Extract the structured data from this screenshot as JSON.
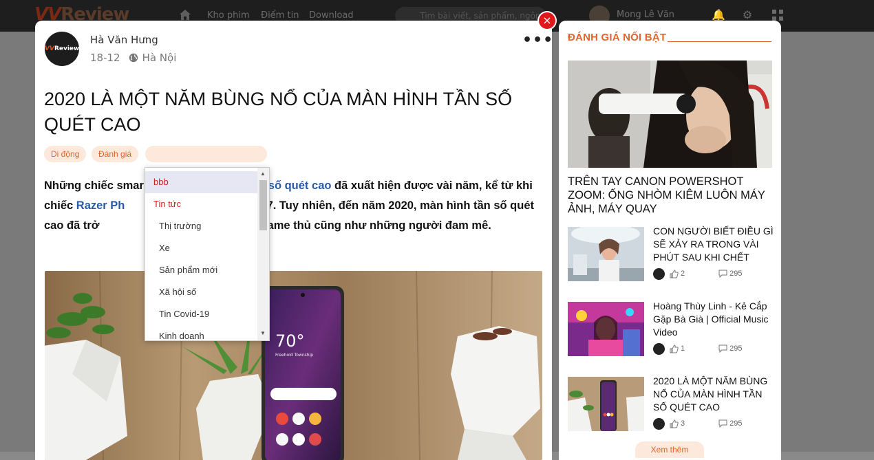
{
  "background": {
    "logo": {
      "prefix": "VV",
      "text": "Review"
    },
    "nav": [
      "Kho phim",
      "Điểm tin",
      "Download"
    ],
    "search_placeholder": "Tìm bài viết, sản phẩm, ngôn",
    "user_name": "Mong Lê Văn"
  },
  "post": {
    "author": "Hà Văn Hưng",
    "avatar_text": {
      "prefix": "VV",
      "text": "Review"
    },
    "date": "18-12",
    "location": "Hà Nội",
    "more": "•••",
    "title": "2020 LÀ MỘT NĂM BÙNG NỔ CỦA MÀN HÌNH TẦN SỐ QUÉT CAO",
    "tags": [
      "Di động",
      "Đánh giá"
    ],
    "lead": {
      "part1": "Những chiếc smar",
      "link1": "ần số quét cao",
      "part2": " đã xuất hiện được vài năm, kể từ khi chiếc ",
      "link2": "Razer Ph",
      "part3": "n 2017. Tuy nhiên, đến năm 2020, màn hình tần số quét cao đã trở",
      "part4": "ú vị dành cho game thủ cũng như những người đam mê."
    },
    "phone_temp": "70°",
    "phone_location": "Freehold Township"
  },
  "close_symbol": "×",
  "dropdown": {
    "selected": "bbb",
    "group": "Tin tức",
    "items": [
      "Thị trường",
      "Xe",
      "Sản phẩm mới",
      "Xã hội số",
      "Tin Covid-19",
      "Kinh doanh"
    ]
  },
  "sidebar": {
    "title": "ĐÁNH GIÁ NỔI BẬT",
    "feature_title": "TRÊN TAY CANON POWERSHOT ZOOM: ỐNG NHÒM KIÊM LUÔN MÁY ẢNH, MÁY QUAY",
    "items": [
      {
        "title": "CON NGƯỜI BIẾT ĐIỀU GÌ SẼ XẢY RA TRONG VÀI PHÚT SAU KHI CHẾT",
        "likes": "2",
        "comments": "295"
      },
      {
        "title": "Hoàng Thùy Linh - Kẻ Cắp Gặp Bà Già | Official Music Video",
        "likes": "1",
        "comments": "295"
      },
      {
        "title": "2020 LÀ MỘT NĂM BÙNG NỔ CỦA MÀN HÌNH TẦN SỐ QUÉT CAO",
        "likes": "3",
        "comments": "295"
      }
    ],
    "see_more": "Xem thêm"
  },
  "colors": {
    "accent": "#e0642b",
    "tag_bg": "#fde9dc",
    "close": "#e2171c",
    "link": "#2a5aa8"
  }
}
